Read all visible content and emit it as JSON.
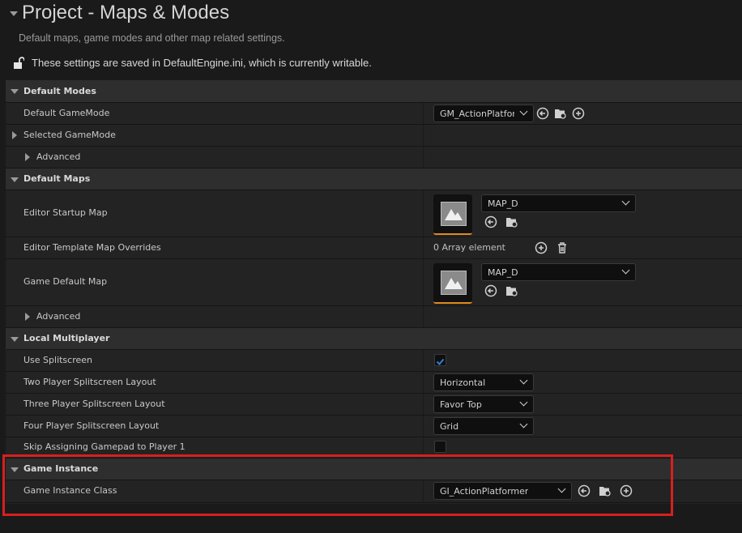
{
  "header": {
    "title": "Project - Maps & Modes",
    "subtitle": "Default maps, game modes and other map related settings.",
    "notice": "These settings are saved in DefaultEngine.ini, which is currently writable."
  },
  "sections": {
    "default_modes": {
      "label": "Default Modes",
      "default_gamemode_label": "Default GameMode",
      "default_gamemode_value": "GM_ActionPlatfor",
      "selected_gamemode_label": "Selected GameMode",
      "advanced_label": "Advanced"
    },
    "default_maps": {
      "label": "Default Maps",
      "editor_startup_map_label": "Editor Startup Map",
      "editor_startup_map_value": "MAP_D",
      "template_overrides_label": "Editor Template Map Overrides",
      "template_overrides_value": "0 Array element",
      "game_default_map_label": "Game Default Map",
      "game_default_map_value": "MAP_D",
      "advanced_label": "Advanced"
    },
    "local_multiplayer": {
      "label": "Local Multiplayer",
      "use_splitscreen_label": "Use Splitscreen",
      "use_splitscreen_checked": true,
      "two_player_label": "Two Player Splitscreen Layout",
      "two_player_value": "Horizontal",
      "three_player_label": "Three Player Splitscreen Layout",
      "three_player_value": "Favor Top",
      "four_player_label": "Four Player Splitscreen Layout",
      "four_player_value": "Grid",
      "skip_gamepad_label": "Skip Assigning Gamepad to Player 1",
      "skip_gamepad_checked": false
    },
    "game_instance": {
      "label": "Game Instance",
      "class_label": "Game Instance Class",
      "class_value": "GI_ActionPlatformer"
    }
  },
  "colors": {
    "accent_check": "#2f7fd8",
    "thumb_underline": "#e08a1e",
    "highlight_border": "#d62020"
  },
  "icons": [
    "lock-open-icon",
    "browse-arrow-icon",
    "folder-search-icon",
    "add-circle-icon",
    "trash-icon",
    "checkmark-icon",
    "chevron-down-icon",
    "map-thumbnail-icon"
  ]
}
